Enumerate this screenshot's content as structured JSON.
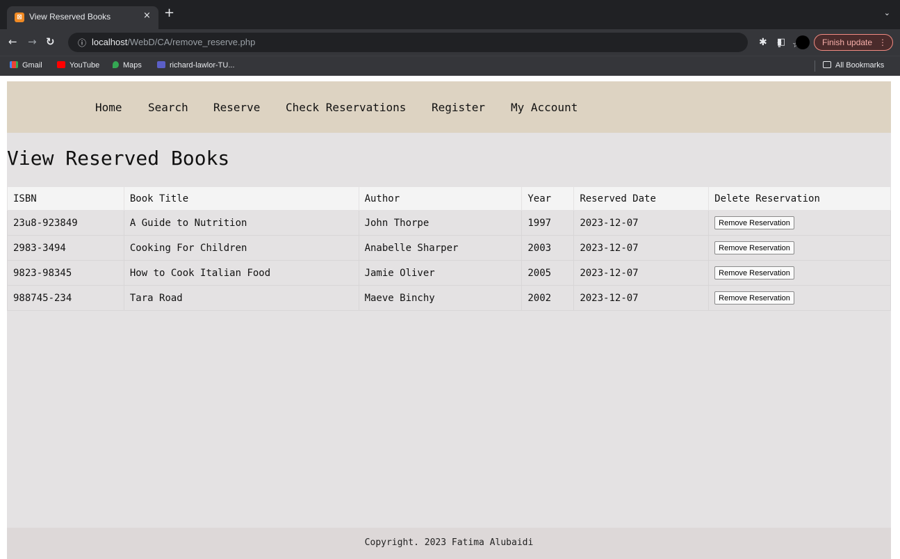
{
  "browser": {
    "tab_title": "View Reserved Books",
    "tab_close": "×",
    "new_tab": "+",
    "tab_menu": "⌄",
    "url_host": "localhost",
    "url_path": "/WebD/CA/remove_reserve.php",
    "update_label": "Finish update",
    "bookmarks": [
      "Gmail",
      "YouTube",
      "Maps",
      "richard-lawlor-TU..."
    ],
    "all_bookmarks": "All Bookmarks",
    "icons": [
      "back-icon",
      "forward-icon",
      "reload-icon",
      "info-icon",
      "share-icon",
      "star-icon",
      "extensions-icon",
      "sidepanel-icon"
    ]
  },
  "site_nav": {
    "links": [
      "Home",
      "Search",
      "Reserve",
      "Check Reservations",
      "Register",
      "My Account"
    ]
  },
  "main": {
    "title": "View Reserved Books",
    "table": {
      "headers": [
        "ISBN",
        "Book Title",
        "Author",
        "Year",
        "Reserved Date",
        "Delete Reservation"
      ],
      "rows": [
        [
          "23u8-923849",
          "A Guide to Nutrition",
          "John Thorpe",
          "1997",
          "2023-12-07"
        ],
        [
          "2983-3494",
          "Cooking For Children",
          "Anabelle Sharper",
          "2003",
          "2023-12-07"
        ],
        [
          "9823-98345",
          "How to Cook Italian Food",
          "Jamie Oliver",
          "2005",
          "2023-12-07"
        ],
        [
          "988745-234",
          "Tara Road",
          "Maeve Binchy",
          "2002",
          "2023-12-07"
        ]
      ],
      "button_label": "Remove Reservation"
    }
  },
  "footer": {
    "text": "Copyright. 2023 Fatima Alubaidi"
  },
  "colors": {
    "nav_bg": "#ddd3c2",
    "content_bg": "#e4e2e3",
    "footer_bg": "#ddd8d8",
    "browser_dark": "#202124"
  }
}
